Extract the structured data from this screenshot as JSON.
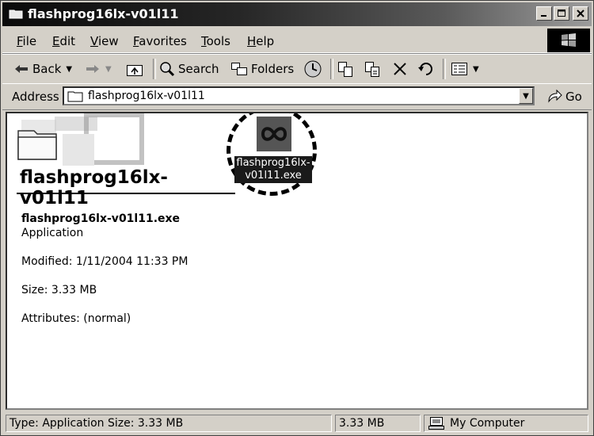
{
  "window": {
    "title": "flashprog16lx-v01l11",
    "controls": [
      "_",
      "□",
      "X"
    ]
  },
  "menu": {
    "items": [
      {
        "label": "File",
        "accel": "F",
        "rest": "ile"
      },
      {
        "label": "Edit",
        "accel": "E",
        "rest": "dit"
      },
      {
        "label": "View",
        "accel": "V",
        "rest": "iew"
      },
      {
        "label": "Favorites",
        "accel": "F",
        "rest": "avorites"
      },
      {
        "label": "Tools",
        "accel": "T",
        "rest": "ools"
      },
      {
        "label": "Help",
        "accel": "H",
        "rest": "elp"
      }
    ]
  },
  "toolbar": {
    "back_label": "Back",
    "search_label": "Search",
    "folders_label": "Folders"
  },
  "address": {
    "label": "Address",
    "value": "flashprog16lx-v01l11",
    "go_label": "Go"
  },
  "content": {
    "folder_title": "flashprog16lx-v01l11",
    "file_icon_label": "flashprog16lx-v01l11.exe",
    "details": {
      "filename": "flashprog16lx-v01l11.exe",
      "type": "Application",
      "modified": "Modified: 1/11/2004 11:33 PM",
      "size": "Size: 3.33 MB",
      "attributes": "Attributes: (normal)"
    }
  },
  "status": {
    "info": "Type: Application Size: 3.33 MB",
    "size": "3.33 MB",
    "zone": "My Computer"
  },
  "icons": [
    "folder-icon",
    "windows-logo-icon",
    "back-icon",
    "forward-icon",
    "up-folder-icon",
    "search-icon",
    "folders-icon",
    "history-icon",
    "move-to-icon",
    "copy-to-icon",
    "delete-icon",
    "undo-icon",
    "views-icon",
    "go-icon",
    "application-icon",
    "computer-icon"
  ]
}
